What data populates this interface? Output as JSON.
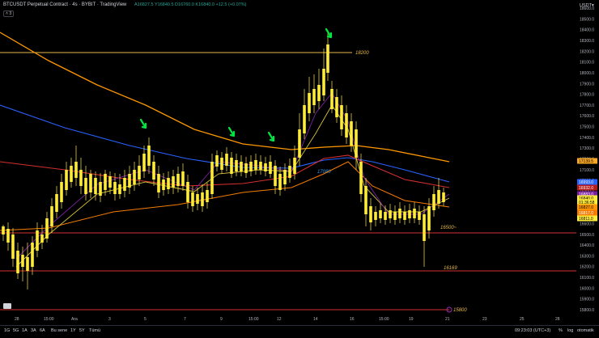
{
  "header": {
    "title": "BTCUSDT Perpetual Contract · 4s · BYBIT · TradingView",
    "ohlc": "A16827.5 Y16840.5 D16760.0 K16840.0 +12.5 (+0.07%)",
    "indicator_count": "3"
  },
  "price_axis": {
    "currency": "USDT▾",
    "labels": [
      "18600.0",
      "18500.0",
      "18400.0",
      "18300.0",
      "18200.0",
      "18100.0",
      "18000.0",
      "17900.0",
      "17800.0",
      "17700.0",
      "17600.0",
      "17500.0",
      "17400.0",
      "17300.0",
      "17200.0",
      "17100.0",
      "17000.0",
      "16900.0",
      "16800.0",
      "16700.0",
      "16600.0",
      "16500.0",
      "16400.0",
      "16300.0",
      "16200.0",
      "16100.0",
      "16000.0",
      "15900.0",
      "15800.0"
    ],
    "tags": [
      {
        "text": "17139.5",
        "color": "#f9a825"
      },
      {
        "text": "16993.0",
        "color": "#2962ff"
      },
      {
        "text": "16932.0",
        "color": "#b71c1c"
      },
      {
        "text": "16883.0",
        "color": "#7b1fa2"
      },
      {
        "text": "16840.0",
        "color": "#ffeb3b"
      },
      {
        "text": "01:36:58",
        "color": "#ffeb3b"
      },
      {
        "text": "16827.0",
        "color": "#ff9800"
      },
      {
        "text": "16817.0",
        "color": "#f57c00"
      },
      {
        "text": "16811.0",
        "color": "#ffeb3b"
      }
    ]
  },
  "time_axis": {
    "labels": [
      "28",
      "15:00",
      "Ara",
      "3",
      "5",
      "7",
      "9",
      "15:00",
      "12",
      "14",
      "16",
      "15:00",
      "19",
      "21",
      "23",
      "25",
      "28"
    ]
  },
  "drawings": {
    "line_18200": "18200",
    "label_17080": "17080",
    "line_16500": "16500~",
    "line_16169": "16169",
    "line_15800": "15800"
  },
  "bottom_toolbar": {
    "ranges": [
      "1G",
      "5G",
      "1A",
      "3A",
      "6A",
      "Bu sene",
      "1Y",
      "5Y",
      "Tümü"
    ],
    "time": "09:23:03 (UTC+3)",
    "pct": "%",
    "log": "log",
    "auto": "otomatik"
  },
  "colors": {
    "candle": "#ffeb3b",
    "arrow": "#00e640",
    "hline_gold": "#e6b84a",
    "hline_red": "#d32f2f"
  }
}
